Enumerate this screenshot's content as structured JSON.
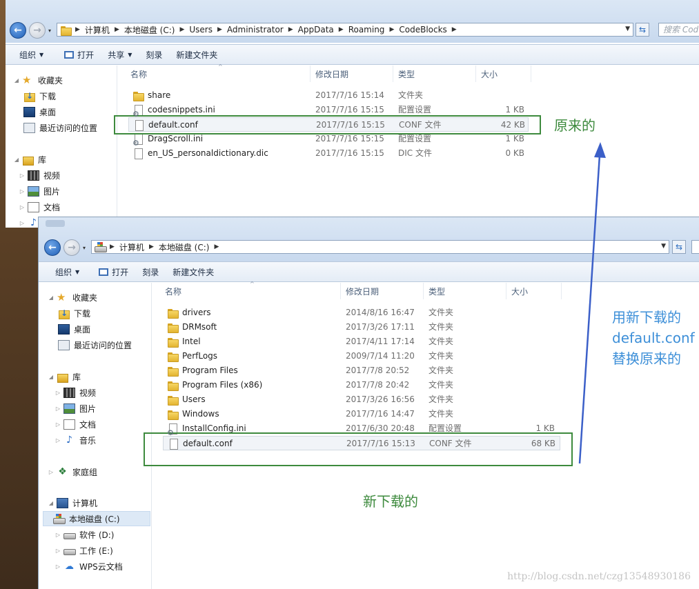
{
  "window_top": {
    "address": [
      "计算机",
      "本地磁盘 (C:)",
      "Users",
      "Administrator",
      "AppData",
      "Roaming",
      "CodeBlocks"
    ],
    "search_placeholder": "搜索 Cod",
    "toolbar": {
      "organize": "组织",
      "open": "打开",
      "share": "共享",
      "burn": "刻录",
      "new_folder": "新建文件夹"
    },
    "nav": {
      "favorites": "收藏夹",
      "downloads": "下载",
      "desktop": "桌面",
      "recent": "最近访问的位置",
      "libraries": "库",
      "videos": "视频",
      "pictures": "图片",
      "documents": "文档"
    },
    "columns": {
      "name": "名称",
      "date": "修改日期",
      "type": "类型",
      "size": "大小"
    },
    "files": [
      {
        "name": "share",
        "date": "2017/7/16 15:14",
        "type": "文件夹",
        "size": "",
        "icon": "folder-icon"
      },
      {
        "name": "codesnippets.ini",
        "date": "2017/7/16 15:15",
        "type": "配置设置",
        "size": "1 KB",
        "icon": "ini-file-icon"
      },
      {
        "name": "default.conf",
        "date": "2017/7/16 15:15",
        "type": "CONF 文件",
        "size": "42 KB",
        "icon": "file-icon"
      },
      {
        "name": "DragScroll.ini",
        "date": "2017/7/16 15:15",
        "type": "配置设置",
        "size": "1 KB",
        "icon": "ini-file-icon"
      },
      {
        "name": "en_US_personaldictionary.dic",
        "date": "2017/7/16 15:15",
        "type": "DIC 文件",
        "size": "0 KB",
        "icon": "file-icon"
      }
    ]
  },
  "window_bottom": {
    "address": [
      "计算机",
      "本地磁盘 (C:)"
    ],
    "toolbar": {
      "organize": "组织",
      "open": "打开",
      "burn": "刻录",
      "new_folder": "新建文件夹"
    },
    "nav": {
      "favorites": "收藏夹",
      "downloads": "下载",
      "desktop": "桌面",
      "recent": "最近访问的位置",
      "libraries": "库",
      "videos": "视频",
      "pictures": "图片",
      "documents": "文档",
      "music": "音乐",
      "homegroup": "家庭组",
      "computer": "计算机",
      "drive_c": "本地磁盘 (C:)",
      "drive_d": "软件 (D:)",
      "drive_e": "工作 (E:)",
      "wps": "WPS云文档"
    },
    "columns": {
      "name": "名称",
      "date": "修改日期",
      "type": "类型",
      "size": "大小"
    },
    "files": [
      {
        "name": "drivers",
        "date": "2014/8/16 16:47",
        "type": "文件夹",
        "size": "",
        "icon": "folder-icon"
      },
      {
        "name": "DRMsoft",
        "date": "2017/3/26 17:11",
        "type": "文件夹",
        "size": "",
        "icon": "folder-icon"
      },
      {
        "name": "Intel",
        "date": "2017/4/11 17:14",
        "type": "文件夹",
        "size": "",
        "icon": "folder-icon"
      },
      {
        "name": "PerfLogs",
        "date": "2009/7/14 11:20",
        "type": "文件夹",
        "size": "",
        "icon": "folder-icon"
      },
      {
        "name": "Program Files",
        "date": "2017/7/8 20:52",
        "type": "文件夹",
        "size": "",
        "icon": "folder-icon"
      },
      {
        "name": "Program Files (x86)",
        "date": "2017/7/8 20:42",
        "type": "文件夹",
        "size": "",
        "icon": "folder-icon"
      },
      {
        "name": "Users",
        "date": "2017/3/26 16:56",
        "type": "文件夹",
        "size": "",
        "icon": "folder-icon"
      },
      {
        "name": "Windows",
        "date": "2017/7/16 14:47",
        "type": "文件夹",
        "size": "",
        "icon": "folder-icon"
      },
      {
        "name": "InstallConfig.ini",
        "date": "2017/6/30 20:48",
        "type": "配置设置",
        "size": "1 KB",
        "icon": "ini-file-icon"
      },
      {
        "name": "default.conf",
        "date": "2017/7/16 15:13",
        "type": "CONF 文件",
        "size": "68 KB",
        "icon": "file-icon"
      }
    ]
  },
  "annotations": {
    "original": "原来的",
    "new_download": "新下载的",
    "replace_line1": "用新下载的",
    "replace_line2": "default.conf",
    "replace_line3": "替换原来的",
    "watermark": "http://blog.csdn.net/czg13548930186",
    "green_color": "#3d8a3d",
    "blue_color": "#3d8fd8",
    "arrow_color": "#3b5fc8"
  }
}
